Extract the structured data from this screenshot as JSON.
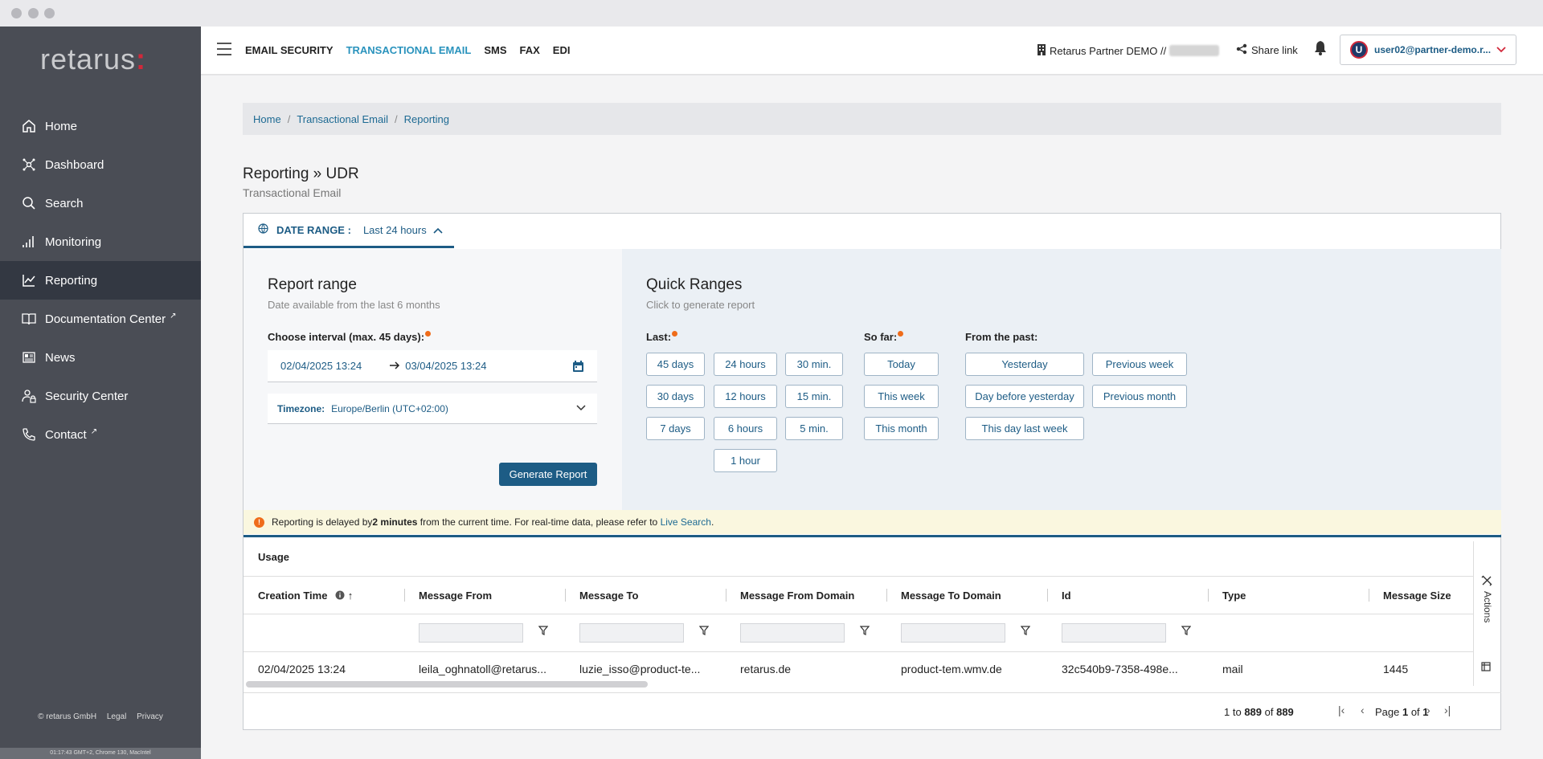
{
  "sidebar": {
    "logo": "retarus",
    "items": [
      {
        "label": "Home",
        "icon": "home-icon"
      },
      {
        "label": "Dashboard",
        "icon": "dashboard-icon"
      },
      {
        "label": "Search",
        "icon": "search-icon"
      },
      {
        "label": "Monitoring",
        "icon": "monitoring-icon"
      },
      {
        "label": "Reporting",
        "icon": "reporting-icon",
        "active": true
      },
      {
        "label": "Documentation Center",
        "icon": "book-icon",
        "external": true
      },
      {
        "label": "News",
        "icon": "news-icon"
      },
      {
        "label": "Security Center",
        "icon": "user-lock-icon"
      },
      {
        "label": "Contact",
        "icon": "phone-icon",
        "external": true
      }
    ],
    "footer": {
      "copyright": "© retarus GmbH",
      "legal": "Legal",
      "privacy": "Privacy"
    },
    "status": "01:17:43 GMT+2, Chrome 130, MacIntel"
  },
  "topbar": {
    "nav": [
      "EMAIL SECURITY",
      "TRANSACTIONAL EMAIL",
      "SMS",
      "FAX",
      "EDI"
    ],
    "active_nav": "TRANSACTIONAL EMAIL",
    "partner": "Retarus Partner DEMO //",
    "share": "Share link",
    "user": "user02@partner-demo.r...",
    "avatar_letter": "U"
  },
  "breadcrumb": [
    "Home",
    "Transactional Email",
    "Reporting"
  ],
  "page": {
    "title": "Reporting » UDR",
    "subtitle": "Transactional Email"
  },
  "date_tab": {
    "label": "DATE RANGE :",
    "value": "Last 24 hours"
  },
  "report_range": {
    "title": "Report range",
    "subtitle": "Date available from the last 6 months",
    "interval_label": "Choose interval (max. 45 days):",
    "from": "02/04/2025 13:24",
    "to": "03/04/2025 13:24",
    "timezone_label": "Timezone:",
    "timezone_value": "Europe/Berlin (UTC+02:00)",
    "generate": "Generate Report"
  },
  "quick_ranges": {
    "title": "Quick Ranges",
    "subtitle": "Click to generate report",
    "last_label": "Last:",
    "last": [
      "45 days",
      "24 hours",
      "30 min.",
      "30 days",
      "12 hours",
      "15 min.",
      "7 days",
      "6 hours",
      "5 min.",
      "1 hour"
    ],
    "sofar_label": "So far:",
    "sofar": [
      "Today",
      "This week",
      "This month"
    ],
    "past_label": "From the past:",
    "past": [
      "Yesterday",
      "Previous week",
      "Day before yesterday",
      "Previous month",
      "This day last week"
    ]
  },
  "notice": {
    "pre": "Reporting is delayed by ",
    "bold": "2 minutes",
    "post": " from the current time. For real-time data, please refer to ",
    "link": "Live Search",
    "end": "."
  },
  "usage": {
    "title": "Usage",
    "columns": [
      "Creation Time",
      "Message From",
      "Message To",
      "Message From Domain",
      "Message To Domain",
      "Id",
      "Type",
      "Message Size"
    ],
    "row": [
      "02/04/2025 13:24",
      "leila_oghnatoll@retarus...",
      "luzie_isso@product-te...",
      "retarus.de",
      "product-tem.wmv.de",
      "32c540b9-7358-498e...",
      "mail",
      "1445"
    ],
    "actions": "Actions"
  },
  "pager": {
    "from": "1",
    "to": "889",
    "total": "889",
    "page": "1",
    "pages": "1"
  }
}
